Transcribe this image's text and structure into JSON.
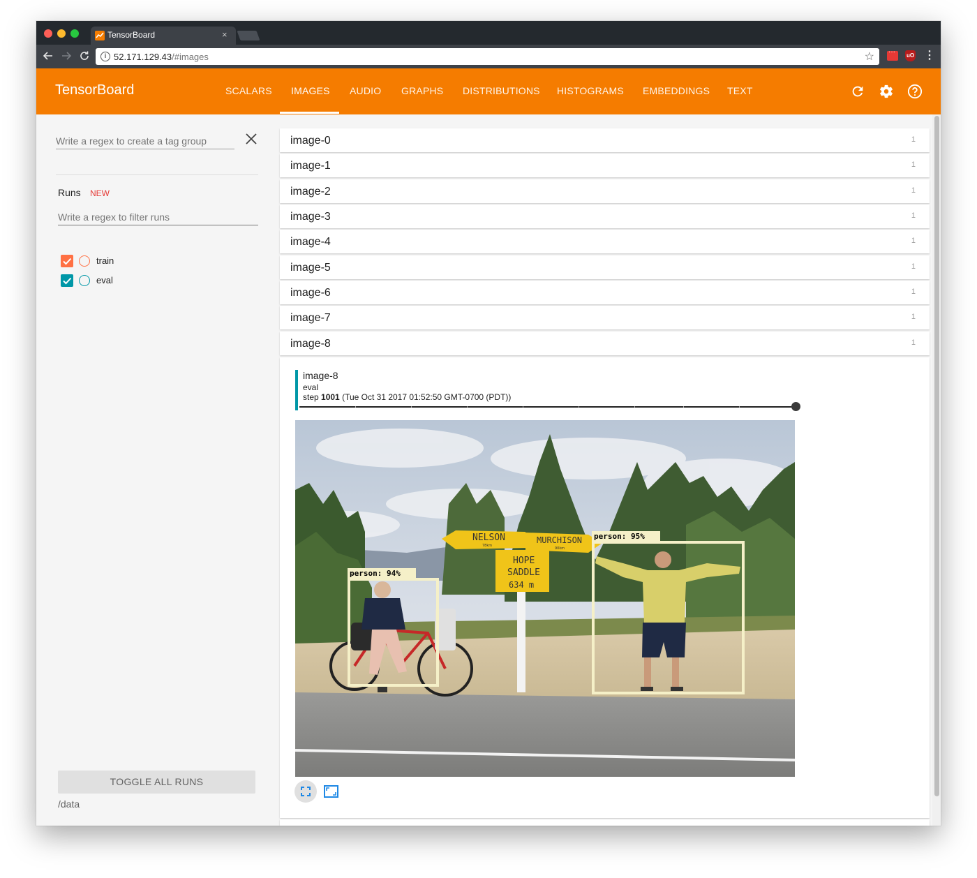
{
  "browser": {
    "tab_title": "TensorBoard",
    "tab_close": "×",
    "url_host": "52.171.129.43",
    "url_path": "/#images"
  },
  "appbar": {
    "brand": "TensorBoard",
    "tabs": [
      {
        "label": "SCALARS"
      },
      {
        "label": "IMAGES"
      },
      {
        "label": "AUDIO"
      },
      {
        "label": "GRAPHS"
      },
      {
        "label": "DISTRIBUTIONS"
      },
      {
        "label": "HISTOGRAMS"
      },
      {
        "label": "EMBEDDINGS"
      },
      {
        "label": "TEXT"
      }
    ],
    "active_tab": "IMAGES",
    "accent_color": "#f57c00"
  },
  "sidebar": {
    "tag_group_placeholder": "Write a regex to create a tag group",
    "runs_title": "Runs",
    "new_badge": "NEW",
    "runs_filter_placeholder": "Write a regex to filter runs",
    "runs": [
      {
        "name": "train",
        "checked": true,
        "color": "#ff7043"
      },
      {
        "name": "eval",
        "checked": true,
        "color": "#0097a7"
      }
    ],
    "toggle_all": "TOGGLE ALL RUNS",
    "data_path": "/data"
  },
  "panes": [
    {
      "name": "image-0",
      "count": "1"
    },
    {
      "name": "image-1",
      "count": "1"
    },
    {
      "name": "image-2",
      "count": "1"
    },
    {
      "name": "image-3",
      "count": "1"
    },
    {
      "name": "image-4",
      "count": "1"
    },
    {
      "name": "image-5",
      "count": "1"
    },
    {
      "name": "image-6",
      "count": "1"
    },
    {
      "name": "image-7",
      "count": "1"
    },
    {
      "name": "image-8",
      "count": "1"
    }
  ],
  "card": {
    "tag": "image-8",
    "run": "eval",
    "step_prefix": "step",
    "step": "1001",
    "timestamp": "(Tue Oct 31 2017 01:52:50 GMT-0700 (PDT))",
    "step_fraction": 1.0,
    "image": {
      "signs": {
        "left": "NELSON",
        "right": "MURCHISON",
        "left_km": "78km",
        "right_km": "90km",
        "main_line1": "HOPE",
        "main_line2": "SADDLE",
        "main_line3": "634 m"
      },
      "detections": [
        {
          "label": "person:  94%"
        },
        {
          "label": "person:  95%"
        }
      ]
    }
  }
}
